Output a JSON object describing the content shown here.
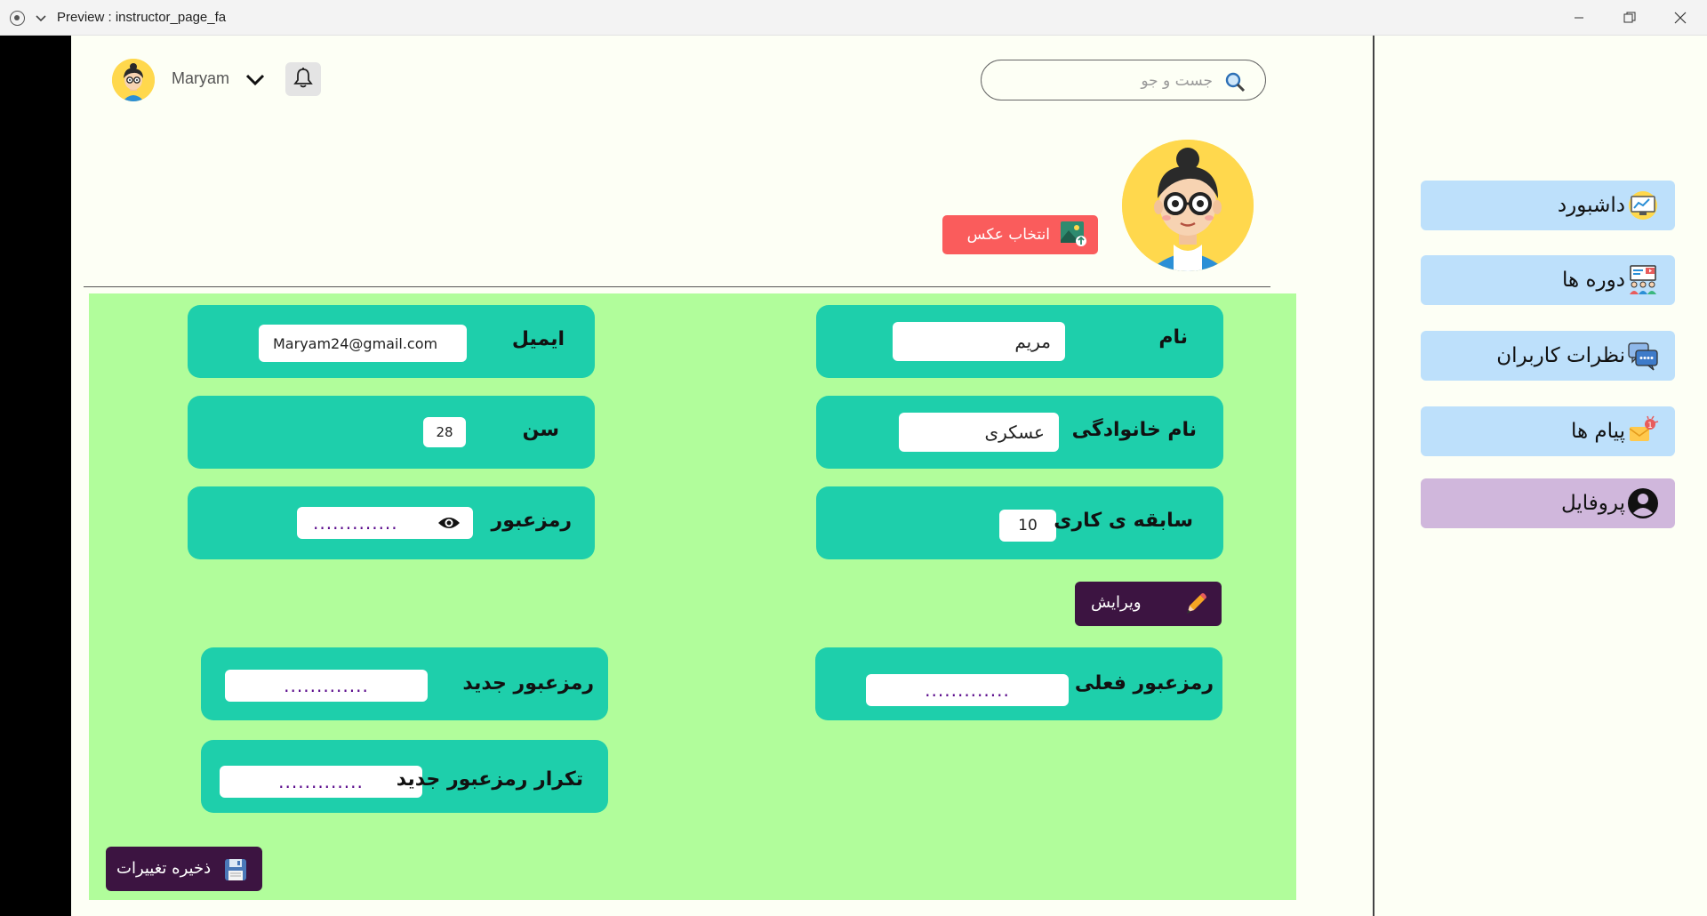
{
  "window": {
    "title": "Preview : instructor_page_fa"
  },
  "header": {
    "user_name": "Maryam",
    "search_placeholder": "جست و جو"
  },
  "sidebar": {
    "items": [
      {
        "label": "داشبورد",
        "icon": "dashboard-icon",
        "active": false
      },
      {
        "label": "دوره ها",
        "icon": "courses-icon",
        "active": false
      },
      {
        "label": "نظرات کاربران",
        "icon": "comments-icon",
        "active": false
      },
      {
        "label": "پیام ها",
        "icon": "messages-icon",
        "active": false,
        "badge": "1"
      },
      {
        "label": "پروفایل",
        "icon": "profile-icon",
        "active": true
      }
    ]
  },
  "profile": {
    "choose_photo_label": "انتخاب عکس"
  },
  "form": {
    "first_name": {
      "label": "نام",
      "value": "مریم"
    },
    "last_name": {
      "label": "نام خانوادگی",
      "value": "عسکری"
    },
    "experience": {
      "label": "سابقه ی کاری",
      "value": "10"
    },
    "email": {
      "label": "ایمیل",
      "value": "Maryam24@gmail.com"
    },
    "age": {
      "label": "سن",
      "value": "28"
    },
    "password": {
      "label": "رمزعبور",
      "value": "............."
    },
    "edit_label": "ویرایش",
    "current_password": {
      "label": "رمزعبور فعلی",
      "value": "............."
    },
    "new_password": {
      "label": "رمزعبور جدید",
      "value": "............."
    },
    "repeat_new_password": {
      "label": "تکرار رمزعبور جدید",
      "value": "............."
    },
    "save_label": "ذخیره تغییرات"
  },
  "colors": {
    "nav_bg": "#bde0fb",
    "nav_active_bg": "#d0b7dc",
    "panel_bg": "#b1fd9b",
    "field_bg": "#1ecfab",
    "button_dark": "#3c1441",
    "choose_photo_bg": "#fa5c5c"
  }
}
